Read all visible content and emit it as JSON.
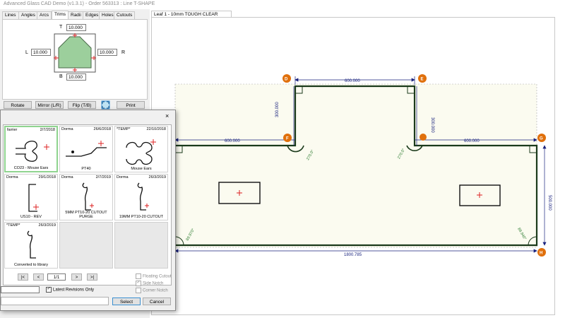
{
  "window": {
    "title": "Advanced Glass CAD Demo (v1.3.1) - Order 563313 : Line  T-SHAPE"
  },
  "tabs": [
    {
      "label": "Lines",
      "active": false
    },
    {
      "label": "Angles",
      "active": false
    },
    {
      "label": "Arcs",
      "active": false
    },
    {
      "label": "Trims",
      "active": true
    },
    {
      "label": "Radii",
      "active": false
    },
    {
      "label": "Edges",
      "active": false
    },
    {
      "label": "Holes",
      "active": false
    },
    {
      "label": "Cutouts",
      "active": false
    }
  ],
  "trims": {
    "top_label": "T",
    "top_value": "10.000",
    "left_label": "L",
    "left_value": "10.000",
    "right_label": "R",
    "right_value": "10.000",
    "bottom_label": "B",
    "bottom_value": "10.000"
  },
  "toolbar": {
    "rotate": "Rotate",
    "mirror": "Mirror (L/R)",
    "flip": "Flip (T/B)",
    "print": "Print",
    "fit_icon": "fit-view-icon"
  },
  "leaf_tab": {
    "label": "Leaf 1 - 10mm TOUGH CLEAR"
  },
  "drawing": {
    "markers": [
      "D",
      "E",
      "F",
      "G",
      "H"
    ],
    "dims": {
      "top": "600.000",
      "left_step": "300.000",
      "right_step": "300.000",
      "left_width": "600.000",
      "right_width": "600.000",
      "height": "500.000",
      "total_width": "1800.785"
    },
    "angles": {
      "left_notch": "270.0°",
      "right_notch": "270.0°",
      "bottom_left": "89.970°",
      "bottom_right": "89.940°"
    }
  },
  "library": {
    "close_label": "×",
    "items": [
      {
        "by": "farrier",
        "date": "2/7/2018",
        "caption": "CO23 - Mouse Ears",
        "selected": true
      },
      {
        "by": "Dorma",
        "date": "26/6/2018",
        "caption": "PT40",
        "selected": false
      },
      {
        "by": "*TEMP*",
        "date": "22/10/2018",
        "caption": "Mouse Ears",
        "selected": false
      },
      {
        "by": "Dorma",
        "date": "29/1/2018",
        "caption": "US10 - REV",
        "selected": false
      },
      {
        "by": "Dorma",
        "date": "2/7/2019",
        "caption": "5MM PT10-20 CUTOUT PURGE",
        "selected": false
      },
      {
        "by": "Dorma",
        "date": "26/3/2019",
        "caption": "19MM PT10-20 CUTOUT",
        "selected": false
      },
      {
        "by": "*TEMP*",
        "date": "26/3/2019",
        "caption": "Converted to library",
        "selected": false
      }
    ],
    "nav": {
      "first": "|<",
      "prev": "<",
      "page": "1/1",
      "next": ">",
      "last": ">|"
    },
    "options": [
      {
        "label": "Floating Cutout",
        "checked": false,
        "enabled": false
      },
      {
        "label": "Side Notch",
        "checked": true,
        "enabled": false
      },
      {
        "label": "Corner Notch",
        "checked": false,
        "enabled": false
      }
    ],
    "latest_revisions": {
      "label": "Latest Revisions Only",
      "checked": true
    },
    "search_value": "",
    "select_label": "Select",
    "cancel_label": "Cancel"
  },
  "colors": {
    "marker": "#e0700c",
    "dim": "#1a237e",
    "angle": "#2e7d32",
    "shape": "#1b3a1b",
    "sheet": "#fbfbf0"
  }
}
